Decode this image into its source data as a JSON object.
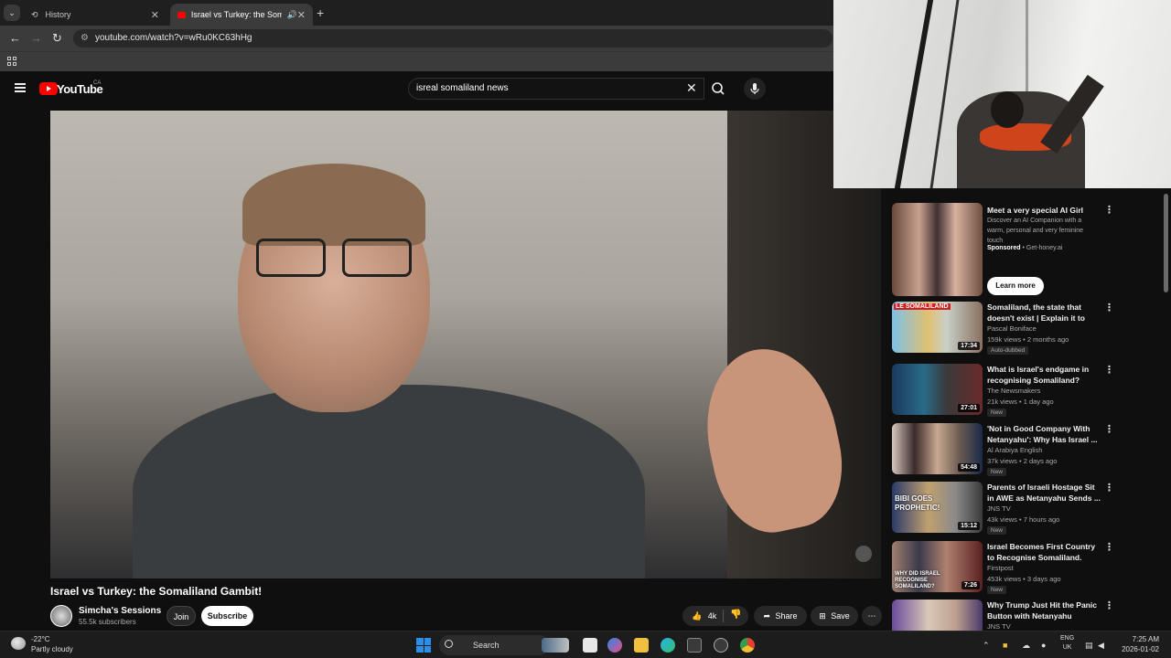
{
  "browser": {
    "tabs": [
      {
        "label": "History"
      },
      {
        "label": "Israel vs Turkey: the Somali"
      }
    ],
    "url": "youtube.com/watch?v=wRu0KC63hHg"
  },
  "youtube": {
    "logo_text": "YouTube",
    "country": "CA",
    "search_query": "isreal somaliland news"
  },
  "video": {
    "title": "Israel vs Turkey: the Somaliland Gambit!",
    "channel_name": "Simcha's Sessions",
    "subscribers": "55.5k subscribers",
    "join_label": "Join",
    "subscribe_label": "Subscribe",
    "likes": "4k",
    "share_label": "Share",
    "save_label": "Save"
  },
  "sidebar": {
    "ad": {
      "title": "Meet a very special AI Girl",
      "description": "Discover an AI Companion with a warm, personal and very feminine touch",
      "sponsored": "Sponsored",
      "domain": "Get-honey.ai",
      "cta": "Learn more"
    },
    "items": [
      {
        "title": "Somaliland, the state that doesn't exist | Explain it to me...",
        "channel": "Pascal Boniface",
        "meta": "159k views • 2 months ago",
        "badge": "Auto-dubbed",
        "duration": "17:34",
        "thumb_label": "LE SOMALILAND"
      },
      {
        "title": "What is Israel's endgame in recognising Somaliland?",
        "channel": "The Newsmakers",
        "meta": "21k views • 1 day ago",
        "badge": "New",
        "duration": "27:01"
      },
      {
        "title": "'Not in Good Company With Netanyahu': Why Has Israel ...",
        "channel": "Al Arabiya English",
        "meta": "37k views • 2 days ago",
        "badge": "New",
        "duration": "54:48"
      },
      {
        "title": "Parents of Israeli Hostage Sit in AWE as Netanyahu Sends ...",
        "channel": "JNS TV",
        "meta": "43k views • 7 hours ago",
        "badge": "New",
        "duration": "15:12",
        "thumb_label": "BIBI GOES PROPHETIC!"
      },
      {
        "title": "Israel Becomes First Country to Recognise Somaliland. Here's ...",
        "channel": "Firstpost",
        "meta": "453k views • 3 days ago",
        "badge": "New",
        "duration": "7:26",
        "thumb_label": "WHY DID ISRAEL RECOGNISE SOMALILAND?"
      },
      {
        "title": "Why Trump Just Hit the Panic Button with Netanyahu",
        "channel": "JNS TV"
      }
    ]
  },
  "taskbar": {
    "temp": "-22°C",
    "condition": "Partly cloudy",
    "search_label": "Search",
    "lang": "ENG",
    "region": "UK",
    "time": "7:25 AM",
    "date": "2026-01-02"
  }
}
